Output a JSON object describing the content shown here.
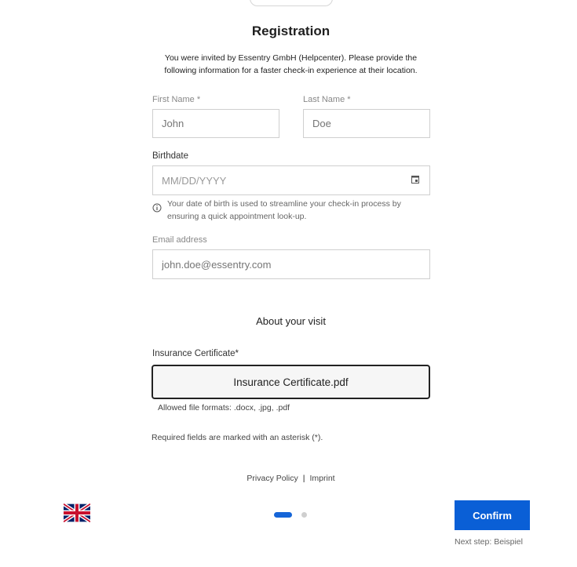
{
  "header": {
    "title": "Registration",
    "intro": "You were invited by Essentry GmbH (Helpcenter). Please provide the following information for a faster check-in experience at their location."
  },
  "form": {
    "first_name": {
      "label": "First Name *",
      "placeholder": "John"
    },
    "last_name": {
      "label": "Last Name *",
      "placeholder": "Doe"
    },
    "birthdate": {
      "label": "Birthdate",
      "placeholder": "MM/DD/YYYY",
      "hint": "Your date of birth is used to streamline your check-in process by ensuring a quick appointment look-up."
    },
    "email": {
      "label": "Email address",
      "placeholder": "john.doe@essentry.com"
    }
  },
  "visit": {
    "section_title": "About your visit",
    "insurance_label": "Insurance Certificate*",
    "file_name": "Insurance Certificate.pdf",
    "allowed_formats": "Allowed file formats: .docx, .jpg, .pdf",
    "required_note": "Required fields are marked with an asterisk (*)."
  },
  "footer": {
    "privacy": "Privacy Policy",
    "separator": "|",
    "imprint": "Imprint"
  },
  "navigation": {
    "confirm_label": "Confirm",
    "next_step": "Next step: Beispiel",
    "current_step": 1,
    "total_steps": 2,
    "language": "English (UK)"
  },
  "colors": {
    "accent": "#0a5fd6",
    "border": "#cfcfcf"
  }
}
